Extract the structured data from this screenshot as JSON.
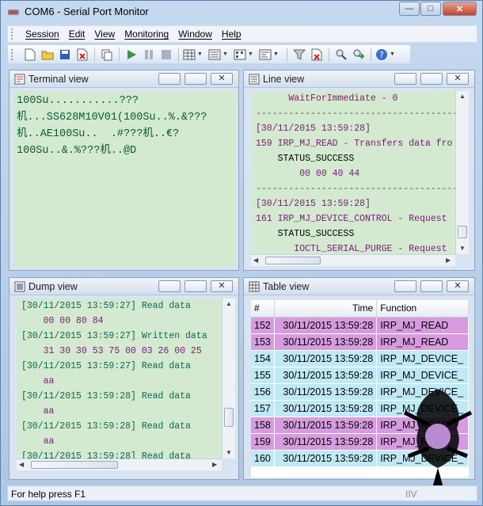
{
  "window": {
    "title": "COM6 - Serial Port Monitor",
    "minimize_glyph": "—",
    "maximize_glyph": "□",
    "close_glyph": "✕"
  },
  "menu": [
    "Session",
    "Edit",
    "View",
    "Monitoring",
    "Window",
    "Help"
  ],
  "toolbar": {
    "icons": [
      "new-icon",
      "open-icon",
      "save-icon",
      "close-session-icon",
      "copy-icon",
      "start-icon",
      "pause-icon",
      "stop-icon",
      "layout-icon",
      "view-dropdown-icon",
      "columns-icon",
      "panel-icon",
      "filter-icon",
      "clear-filter-icon",
      "find-icon",
      "goto-icon",
      "help-icon"
    ]
  },
  "panels": {
    "terminal": {
      "title": "Terminal view",
      "lines": [
        "100Su...........???",
        "机...SS628M10V01(100Su..%.&???",
        "机..AE100Su..  .#???机..€?",
        "100Su..&.%???机..@D"
      ]
    },
    "line": {
      "title": "Line view",
      "lines": [
        {
          "text": "      WaitForImmediate - 0",
          "color": "#8a1a6a"
        },
        {
          "text": "-------------------------------------------",
          "color": "#555555"
        },
        {
          "text": "",
          "color": "#000000"
        },
        {
          "text": "[30/11/2015 13:59:28]",
          "color": "#7a1a7a"
        },
        {
          "text": "159 IRP_MJ_READ - Transfers data fro",
          "color": "#7a1a7a"
        },
        {
          "text": "    STATUS_SUCCESS",
          "color": "#000000"
        },
        {
          "text": "        00 00 40 44",
          "color": "#7a1a7a"
        },
        {
          "text": "-------------------------------------------",
          "color": "#555555"
        },
        {
          "text": "[30/11/2015 13:59:28]",
          "color": "#7a1a7a"
        },
        {
          "text": "161 IRP_MJ_DEVICE_CONTROL - Request",
          "color": "#7a1a7a"
        },
        {
          "text": "    STATUS_SUCCESS",
          "color": "#000000"
        },
        {
          "text": "       IOCTL_SERIAL_PURGE - Request",
          "color": "#7a1a7a"
        }
      ]
    },
    "dump": {
      "title": "Dump view",
      "lines": [
        {
          "text": "[30/11/2015 13:59:27] Read data",
          "color": "#0a6a50"
        },
        {
          "text": "    00 00 80 84",
          "color": "#7a1a7a"
        },
        {
          "text": "[30/11/2015 13:59:27] Written data",
          "color": "#0a6a50"
        },
        {
          "text": "    31 30 30 53 75 00 03 26 00 25",
          "color": "#7a1a7a"
        },
        {
          "text": "[30/11/2015 13:59:27] Read data",
          "color": "#0a6a50"
        },
        {
          "text": "    aa",
          "color": "#7a1a7a"
        },
        {
          "text": "[30/11/2015 13:59:28] Read data",
          "color": "#0a6a50"
        },
        {
          "text": "    aa",
          "color": "#7a1a7a"
        },
        {
          "text": "[30/11/2015 13:59:28] Read data",
          "color": "#0a6a50"
        },
        {
          "text": "    aa",
          "color": "#7a1a7a"
        },
        {
          "text": "[30/11/2015 13:59:28] Read data",
          "color": "#0a6a50"
        }
      ]
    },
    "table": {
      "title": "Table view",
      "headers": [
        "#",
        "Time",
        "Function"
      ],
      "rows": [
        {
          "num": "152",
          "time": "30/11/2015 13:59:28",
          "func": "IRP_MJ_READ",
          "bg": "#d99be0"
        },
        {
          "num": "153",
          "time": "30/11/2015 13:59:28",
          "func": "IRP_MJ_READ",
          "bg": "#d99be0"
        },
        {
          "num": "154",
          "time": "30/11/2015 13:59:28",
          "func": "IRP_MJ_DEVICE_",
          "bg": "#bfe9f5"
        },
        {
          "num": "155",
          "time": "30/11/2015 13:59:28",
          "func": "IRP_MJ_DEVICE_",
          "bg": "#bfe9f5"
        },
        {
          "num": "156",
          "time": "30/11/2015 13:59:28",
          "func": "IRP_MJ_DEVICE_",
          "bg": "#bfe9f5"
        },
        {
          "num": "157",
          "time": "30/11/2015 13:59:28",
          "func": "IRP_MJ_DEVICE_",
          "bg": "#bfe9f5"
        },
        {
          "num": "158",
          "time": "30/11/2015 13:59:28",
          "func": "IRP_MJ_READ",
          "bg": "#d99be0"
        },
        {
          "num": "159",
          "time": "30/11/2015 13:59:28",
          "func": "IRP_MJ_READ",
          "bg": "#d99be0"
        },
        {
          "num": "160",
          "time": "30/11/2015 13:59:28",
          "func": "IRP_MJ_DEVICE_",
          "bg": "#bfe9f5"
        }
      ]
    }
  },
  "status": {
    "text": "For help press F1",
    "right": "IIV"
  },
  "colors": {
    "terminal_bg": "#d3ead1",
    "panel_frame": "#8da4c2",
    "accent_pink": "#d99be0",
    "accent_cyan": "#bfe9f5"
  }
}
